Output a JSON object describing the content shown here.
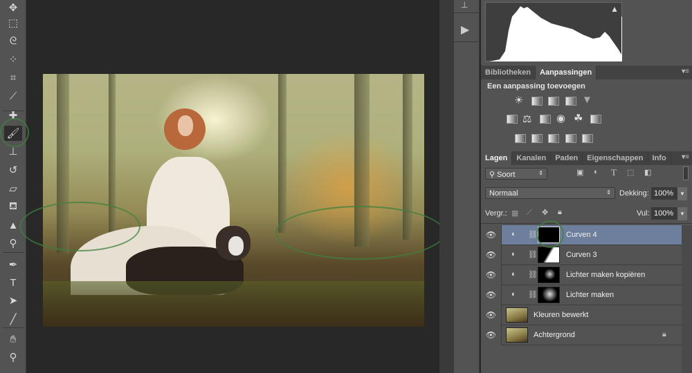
{
  "toolbar": {
    "tools": [
      "move-icon",
      "marquee-icon",
      "lasso-icon",
      "quick-select-icon",
      "crop-icon",
      "eyedropper-icon",
      "healing-icon",
      "brush-icon",
      "stamp-icon",
      "history-brush-icon",
      "eraser-icon",
      "paint-bucket-icon",
      "sharpen-icon",
      "dodge-icon",
      "pen-icon",
      "type-icon",
      "path-select-icon",
      "line-icon",
      "hand-icon",
      "zoom-icon"
    ],
    "active": "brush-icon",
    "type_glyph": "T"
  },
  "adjustments_panel": {
    "tabs": [
      "Bibliotheken",
      "Aanpassingen"
    ],
    "active_tab": "Aanpassingen",
    "heading": "Een aanpassing toevoegen"
  },
  "layers_panel": {
    "tabs": [
      "Lagen",
      "Kanalen",
      "Paden",
      "Eigenschappen",
      "Info"
    ],
    "active_tab": "Lagen",
    "filter": "Soort",
    "blend_mode": "Normaal",
    "opacity_label": "Dekking:",
    "opacity": "100%",
    "lock_label": "Vergr.:",
    "fill_label": "Vul:",
    "fill": "100%",
    "layers": [
      {
        "name": "Curven 4",
        "type": "adjustment",
        "selected": true
      },
      {
        "name": "Curven 3",
        "type": "adjustment"
      },
      {
        "name": "Lichter maken kopiëren",
        "type": "adjustment"
      },
      {
        "name": "Lichter maken",
        "type": "adjustment"
      },
      {
        "name": "Kleuren bewerkt",
        "type": "pixel"
      },
      {
        "name": "Achtergrond",
        "type": "pixel",
        "locked": true
      }
    ]
  },
  "colors": {
    "panel": "#535353",
    "canvas": "#282828",
    "selected_layer": "#6d7f9c",
    "annotation": "#3c823c"
  }
}
